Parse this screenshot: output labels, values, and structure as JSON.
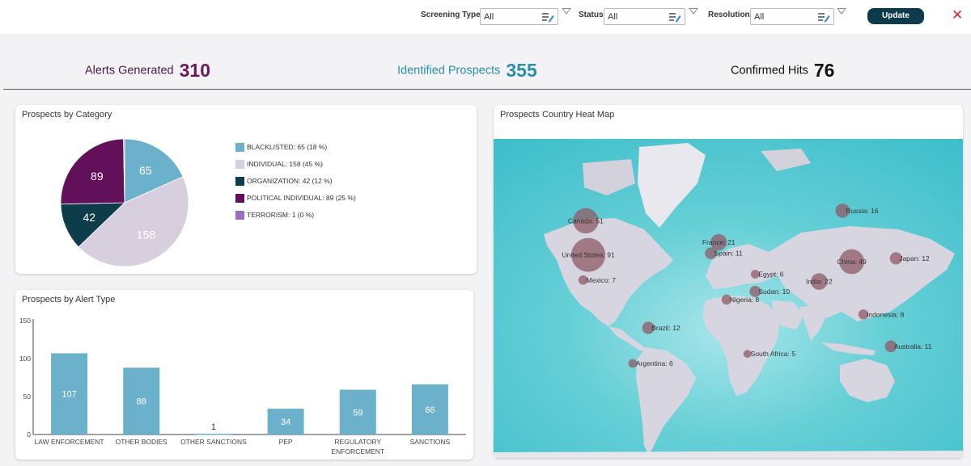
{
  "filters": [
    {
      "label": "Screening Type",
      "value": "All"
    },
    {
      "label": "Status",
      "value": "All"
    },
    {
      "label": "Resolution",
      "value": "All"
    }
  ],
  "update_label": "Update",
  "close_label": "✕",
  "kpis": [
    {
      "label": "Alerts Generated",
      "value": "310",
      "color": "#6a1a5c"
    },
    {
      "label": "Identified Prospects",
      "value": "355",
      "color": "#2b8fa8"
    },
    {
      "label": "Confirmed Hits",
      "value": "76",
      "color": "#111111"
    }
  ],
  "panels": {
    "category_title": "Prospects by Category",
    "alert_type_title": "Prospects by Alert Type",
    "heatmap_title": "Prospects Country Heat Map"
  },
  "chart_data": [
    {
      "type": "pie",
      "title": "Prospects by Category",
      "slices": [
        {
          "name": "BLACKLISTED",
          "value": 65,
          "label": "65",
          "legend": "BLACKLISTED: 65 (18 %)",
          "color": "#6cb1cb"
        },
        {
          "name": "INDIVIDUAL",
          "value": 158,
          "label": "158",
          "legend": "INDIVIDUAL: 158 (45 %)",
          "color": "#d8cfde"
        },
        {
          "name": "ORGANIZATION",
          "value": 42,
          "label": "42",
          "legend": "ORGANIZATION: 42 (12 %)",
          "color": "#0d3d4a"
        },
        {
          "name": "POLITICAL INDIVIDUAL",
          "value": 89,
          "label": "89",
          "legend": "POLITICAL INDIVIDUAL: 89 (25 %)",
          "color": "#63105a"
        },
        {
          "name": "TERRORISM",
          "value": 1,
          "label": "",
          "legend": "TERRORISM: 1 (0 %)",
          "color": "#9b6fc0"
        }
      ],
      "legend_position": "right"
    },
    {
      "type": "bar",
      "title": "Prospects by Alert Type",
      "categories": [
        "LAW ENFORCEMENT",
        "OTHER BODIES",
        "OTHER SANCTIONS",
        "PEP",
        "REGULATORY ENFORCEMENT",
        "SANCTIONS"
      ],
      "category_lines": [
        [
          "LAW ENFORCEMENT"
        ],
        [
          "OTHER BODIES"
        ],
        [
          "OTHER SANCTIONS"
        ],
        [
          "PEP"
        ],
        [
          "REGULATORY",
          "ENFORCEMENT"
        ],
        [
          "SANCTIONS"
        ]
      ],
      "values": [
        107,
        88,
        1,
        34,
        59,
        66
      ],
      "ylim": [
        0,
        150
      ],
      "yticks": [
        0,
        50,
        100,
        150
      ],
      "color": "#6cb1cb"
    }
  ],
  "map_markers": [
    {
      "name": "Canada",
      "label": "Canada: 51",
      "value": 51,
      "lon": -100,
      "lat": 56
    },
    {
      "name": "United States",
      "label": "United States: 91",
      "value": 91,
      "lon": -98,
      "lat": 39
    },
    {
      "name": "Mexico",
      "label": "Mexico: 7",
      "value": 7,
      "lon": -102,
      "lat": 23
    },
    {
      "name": "Brazil",
      "label": "Brazil: 12",
      "value": 12,
      "lon": -52,
      "lat": -12
    },
    {
      "name": "Argentina",
      "label": "Argentina: 6",
      "value": 6,
      "lon": -64,
      "lat": -36
    },
    {
      "name": "France",
      "label": "France: 21",
      "value": 21,
      "lon": 2,
      "lat": 46
    },
    {
      "name": "Spain",
      "label": "Spain: 11",
      "value": 11,
      "lon": -4,
      "lat": 40
    },
    {
      "name": "Egypt",
      "label": "Egypt: 6",
      "value": 6,
      "lon": 30,
      "lat": 27
    },
    {
      "name": "Sudan",
      "label": "Sudan: 10",
      "value": 10,
      "lon": 30,
      "lat": 15
    },
    {
      "name": "Nigeria",
      "label": "Nigeria: 8",
      "value": 8,
      "lon": 8,
      "lat": 9
    },
    {
      "name": "South Africa",
      "label": "South Africa: 5",
      "value": 5,
      "lon": 24,
      "lat": -30
    },
    {
      "name": "Russia",
      "label": "Russia: 16",
      "value": 16,
      "lon": 97,
      "lat": 60
    },
    {
      "name": "China",
      "label": "China: 49",
      "value": 49,
      "lon": 104,
      "lat": 35
    },
    {
      "name": "India",
      "label": "India: 22",
      "value": 22,
      "lon": 79,
      "lat": 22
    },
    {
      "name": "Japan",
      "label": "Japan: 12",
      "value": 12,
      "lon": 138,
      "lat": 37
    },
    {
      "name": "Indonesia",
      "label": "Indonesia: 8",
      "value": 8,
      "lon": 113,
      "lat": -2
    },
    {
      "name": "Australia",
      "label": "Australia: 11",
      "value": 11,
      "lon": 134,
      "lat": -25
    }
  ],
  "colors": {
    "marker": "#8f5a66",
    "ocean": "#5ac9d2",
    "land": "#d7d6e0",
    "accent": "#0d3b4b",
    "close": "#e0262a"
  }
}
